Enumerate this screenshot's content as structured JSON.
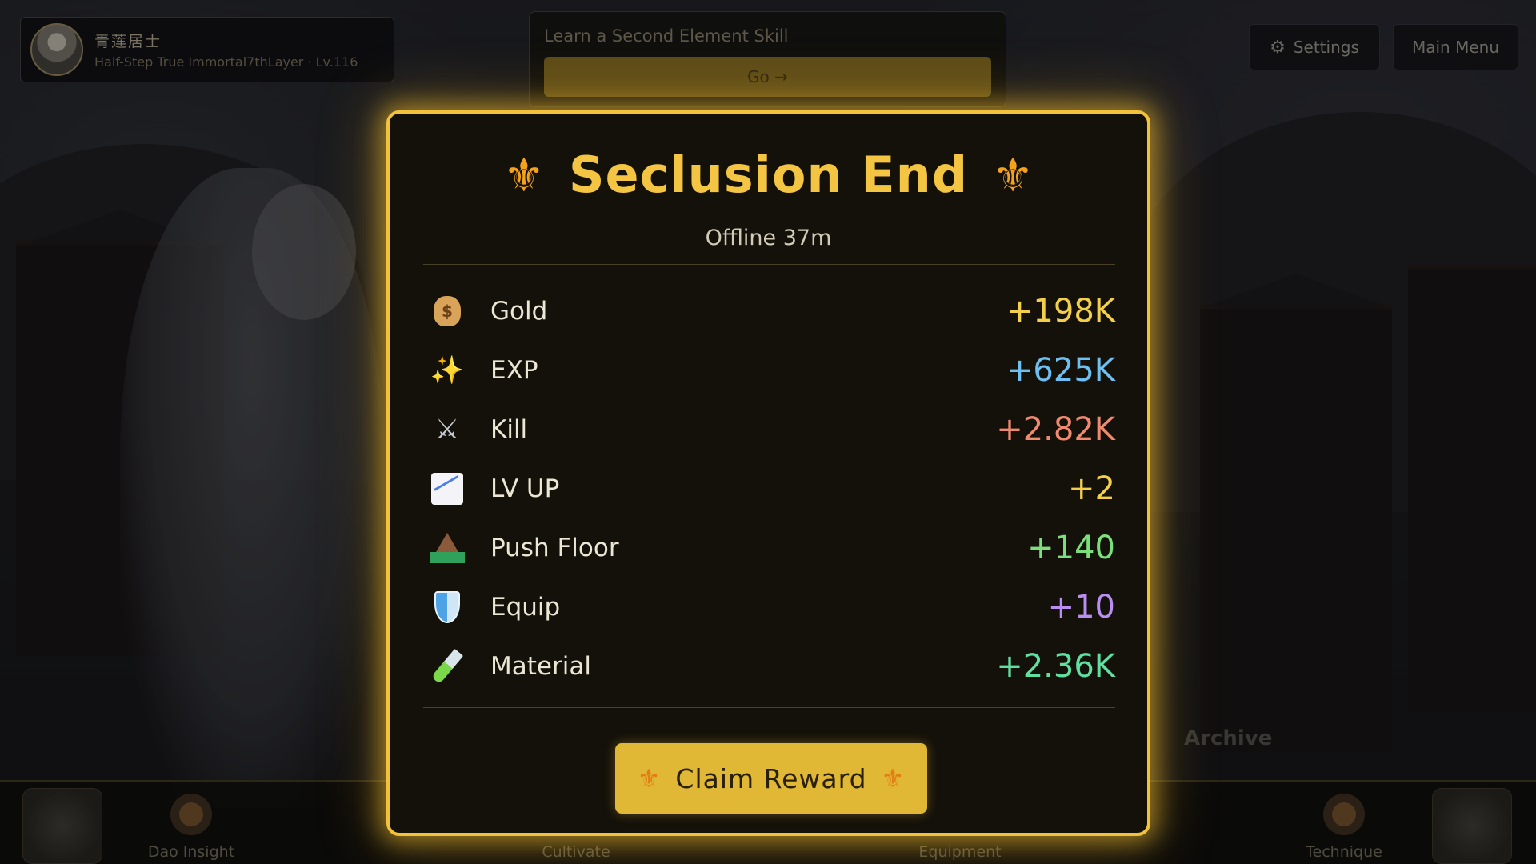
{
  "player": {
    "name": "青莲居士",
    "realm": "Half-Step True Immortal7thLayer · Lv.116"
  },
  "quest": {
    "title": "Learn a Second Element Skill",
    "go_label": "Go →"
  },
  "top_buttons": {
    "settings_label": "Settings",
    "main_menu_label": "Main Menu"
  },
  "bottom_nav": {
    "items": [
      {
        "label": "Dao Insight"
      },
      {
        "label": "Cultivate"
      },
      {
        "label": "Equipment"
      },
      {
        "label": "Technique"
      }
    ],
    "archive_label": "Archive"
  },
  "modal": {
    "title": "Seclusion End",
    "subtitle": "Offline 37m",
    "rows": [
      {
        "icon": "money-bag-icon",
        "label": "Gold",
        "value": "+198K",
        "color": "#f4d04a"
      },
      {
        "icon": "sparkles-icon",
        "label": "EXP",
        "value": "+625K",
        "color": "#6ec0f2"
      },
      {
        "icon": "crossed-swords-icon",
        "label": "Kill",
        "value": "+2.82K",
        "color": "#f08a6e"
      },
      {
        "icon": "chart-up-icon",
        "label": "LV UP",
        "value": "+2",
        "color": "#f4d04a"
      },
      {
        "icon": "mountain-icon",
        "label": "Push Floor",
        "value": "+140",
        "color": "#7be07c"
      },
      {
        "icon": "shield-icon",
        "label": "Equip",
        "value": "+10",
        "color": "#b88ef2"
      },
      {
        "icon": "test-tube-icon",
        "label": "Material",
        "value": "+2.36K",
        "color": "#5fe0a0"
      }
    ],
    "claim_label": "Claim Reward"
  },
  "colors": {
    "accent": "#f2c23c",
    "modal_bg": "#14110a",
    "claim_button": "#e0b836"
  }
}
